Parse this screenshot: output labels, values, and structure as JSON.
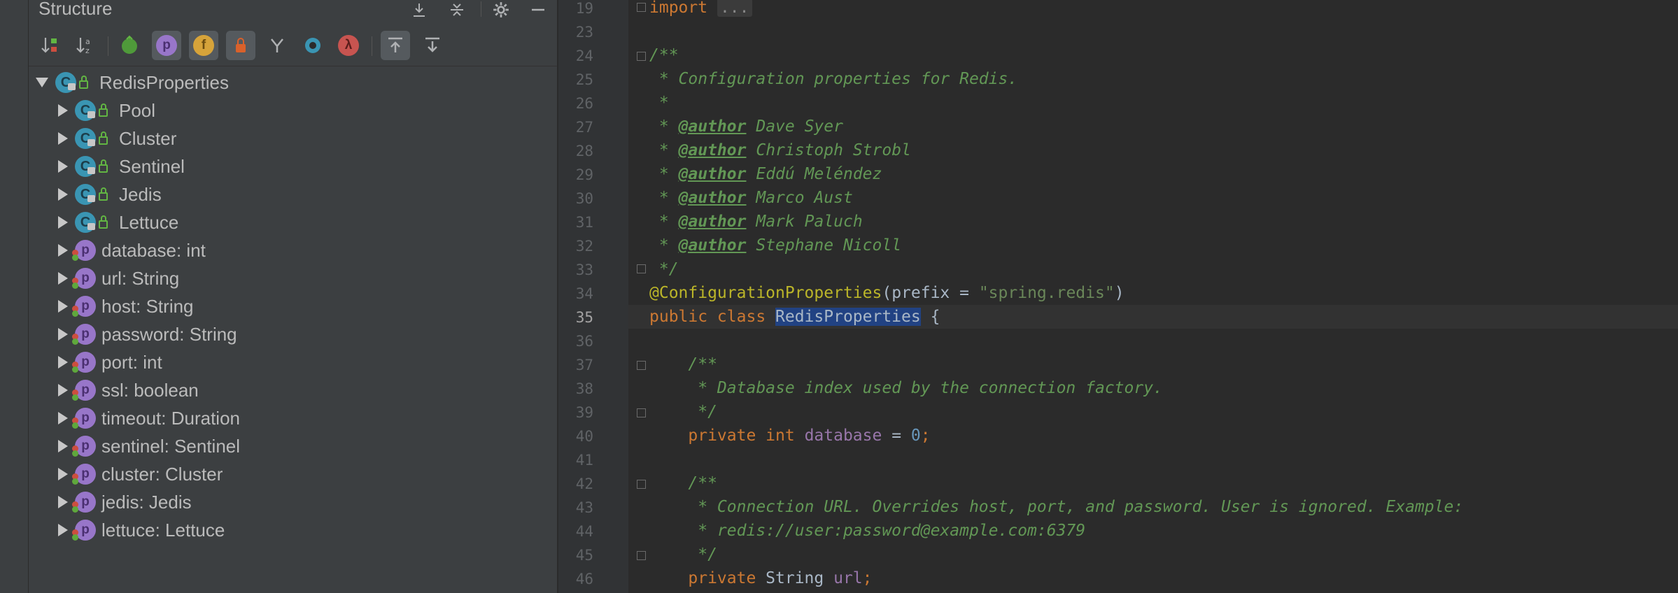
{
  "structure": {
    "title": "Structure",
    "root": {
      "label": "RedisProperties"
    },
    "nested_classes": [
      "Pool",
      "Cluster",
      "Sentinel",
      "Jedis",
      "Lettuce"
    ],
    "fields": [
      "database: int",
      "url: String",
      "host: String",
      "password: String",
      "port: int",
      "ssl: boolean",
      "timeout: Duration",
      "sentinel: Sentinel",
      "cluster: Cluster",
      "jedis: Jedis",
      "lettuce: Lettuce"
    ],
    "icon_letters": {
      "class": "C",
      "property": "p",
      "field": "f",
      "lambda": "λ"
    }
  },
  "editor": {
    "line_numbers": [
      "19",
      "23",
      "24",
      "25",
      "26",
      "27",
      "28",
      "29",
      "30",
      "31",
      "32",
      "33",
      "34",
      "35",
      "36",
      "37",
      "38",
      "39",
      "40",
      "41",
      "42",
      "43",
      "44",
      "45",
      "46"
    ],
    "current_line": "35",
    "code": {
      "l19_kw": "import",
      "l19_fold": "...",
      "l24": "/**",
      "l25": " * Configuration properties for Redis.",
      "l26": " *",
      "author_tag": "@author",
      "authors": [
        "Dave Syer",
        "Christoph Strobl",
        "Eddú Meléndez",
        "Marco Aust",
        "Mark Paluch",
        "Stephane Nicoll"
      ],
      "l33": " */",
      "l34_annotation": "@ConfigurationProperties",
      "l34_open": "(prefix = ",
      "l34_string": "\"spring.redis\"",
      "l34_close": ")",
      "l35_kw": "public class ",
      "l35_name": "RedisProperties",
      "l35_rest": " {",
      "l37": "    /**",
      "l38": "     * Database index used by the connection factory.",
      "l39": "     */",
      "l40_kw": "    private int ",
      "l40_field": "database",
      "l40_eq": " = ",
      "l40_num": "0",
      "l40_semi": ";",
      "l42": "    /**",
      "l43": "     * Connection URL. Overrides host, port, and password. User is ignored. Example:",
      "l44": "     * redis://user:password@example.com:6379",
      "l45": "     */",
      "l46_kw": "    private ",
      "l46_type": "String ",
      "l46_field": "url",
      "l46_semi": ";"
    }
  }
}
